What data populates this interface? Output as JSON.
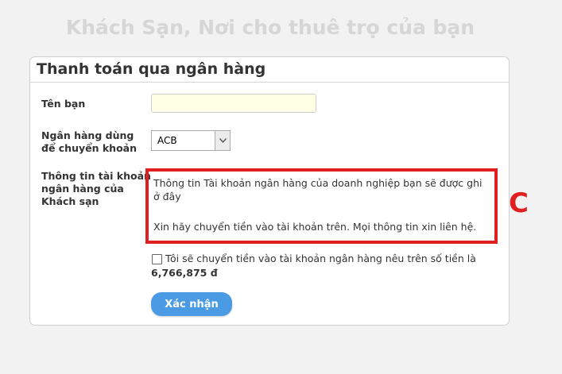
{
  "page_header": "Khách Sạn, Nơi cho thuê trọ của bạn",
  "panel": {
    "title": "Thanh toán qua ngân hàng"
  },
  "form": {
    "name_label": "Tên bạn",
    "name_value": "",
    "bank_label_line1": "Ngân hàng dùng",
    "bank_label_line2": "để chuyển khoản",
    "bank_selected": "ACB",
    "info_label_line1": "Thông tin tài khoản",
    "info_label_line2": "ngân hàng của",
    "info_label_line3": "Khách sạn",
    "info_line1": "Thông tin Tài khoản ngân hàng của doanh nghiệp bạn sẽ được ghi ở đây",
    "info_line2": "Xin hãy chuyển tiền vào tài khoản trên. Mọi thông tin xin liên hệ.",
    "confirm_text": "Tôi sẽ chuyển tiền vào tài khoản ngân hàng nêu trên số tiền là",
    "confirm_amount": "6,766,875 đ",
    "submit_label": "Xác nhận"
  },
  "annotation": {
    "letter": "C",
    "color": "#e02020"
  },
  "colors": {
    "accent": "#4a9be3",
    "input_bg": "#ffffe6"
  }
}
